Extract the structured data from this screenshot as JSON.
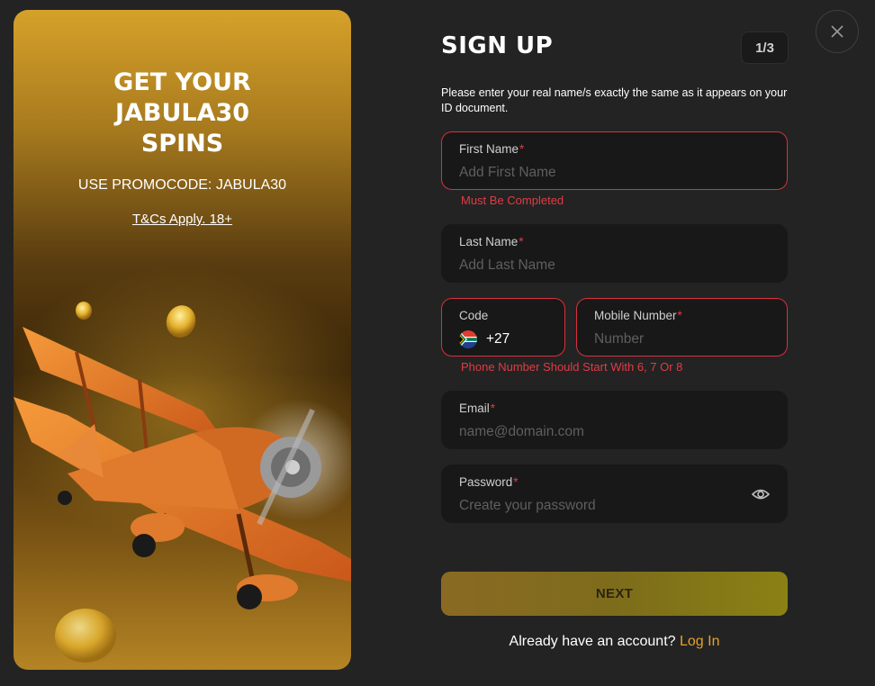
{
  "promo": {
    "title": "GET YOUR\nJABULA30\nSPINS",
    "promocode_text": "USE PROMOCODE: JABULA30",
    "terms_link": "T&Cs Apply. 18+"
  },
  "form": {
    "title": "SIGN UP",
    "step": "1/3",
    "instructions": "Please enter your real name/s exactly the same as it appears on your ID document.",
    "first_name": {
      "label": "First Name",
      "required_mark": "*",
      "placeholder": "Add First Name",
      "value": "",
      "error": "Must Be Completed"
    },
    "last_name": {
      "label": "Last Name",
      "required_mark": "*",
      "placeholder": "Add Last Name",
      "value": ""
    },
    "code": {
      "label": "Code",
      "value": "+27",
      "flag": "south-africa-flag-icon"
    },
    "mobile": {
      "label": "Mobile Number",
      "required_mark": "*",
      "placeholder": "Number",
      "value": "",
      "error": "Phone Number Should Start With 6, 7 Or 8"
    },
    "email": {
      "label": "Email",
      "required_mark": "*",
      "placeholder": "name@domain.com",
      "value": ""
    },
    "password": {
      "label": "Password",
      "required_mark": "*",
      "placeholder": "Create your password",
      "value": ""
    },
    "next_label": "NEXT",
    "login_prompt": "Already have an account?",
    "login_link": "Log In"
  },
  "colors": {
    "accent": "#e3a32a",
    "error": "#e23b45",
    "background": "#232323",
    "field_background": "#181818"
  },
  "icons": {
    "close": "close-icon",
    "password_toggle": "eye-icon"
  }
}
